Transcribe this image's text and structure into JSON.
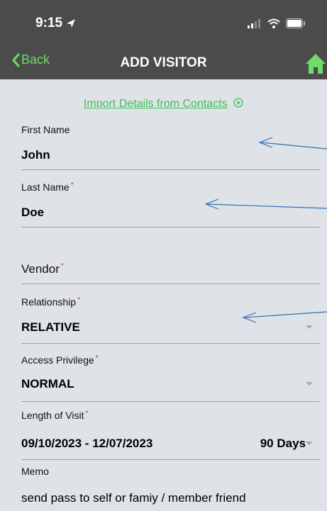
{
  "status": {
    "time": "9:15"
  },
  "nav": {
    "back_label": "Back",
    "title": "ADD VISITOR"
  },
  "import": {
    "label": "Import Details from Contacts"
  },
  "fields": {
    "first_name": {
      "label": "First Name",
      "value": "John"
    },
    "last_name": {
      "label": "Last Name",
      "value": "Doe"
    },
    "vendor": {
      "label": "Vendor"
    },
    "relationship": {
      "label": "Relationship",
      "value": "RELATIVE"
    },
    "access": {
      "label": "Access Privilege",
      "value": "NORMAL"
    },
    "visit": {
      "label": "Length of Visit",
      "value": "09/10/2023 - 12/07/2023",
      "days": "90 Days"
    },
    "memo": {
      "label": "Memo",
      "value": "send pass to self or famiy / member friend"
    }
  },
  "required_mark": "*",
  "colors": {
    "bar": "#4b4b4b",
    "accent": "#6ddc68",
    "link": "#3cc35a",
    "required": "#c0392b",
    "annotation_arrow": "#2f6fb5"
  },
  "icons": [
    "location-arrow-icon",
    "signal-icon",
    "wifi-icon",
    "battery-icon",
    "chevron-left-icon",
    "home-icon",
    "play-circle-icon",
    "dropdown-caret-icon"
  ]
}
